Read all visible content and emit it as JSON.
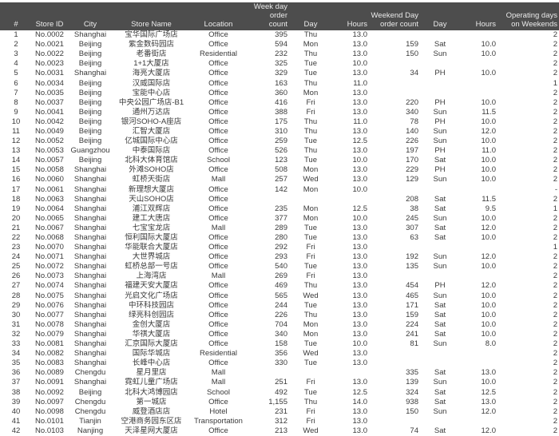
{
  "header": {
    "columns": [
      "#",
      "Store ID",
      "City",
      "Store Name",
      "Location",
      "Week day\norder count",
      "Day",
      "Hours",
      "Weekend Day\norder count",
      "Day",
      "Hours",
      "Operating days\non Weekends"
    ],
    "background_color": "#4d4d4d"
  },
  "rows": [
    [
      "1",
      "No.0002",
      "Shanghai",
      "宝华国际广场店",
      "Office",
      "395",
      "Thu",
      "13.0",
      "",
      "",
      "",
      "2"
    ],
    [
      "2",
      "No.0021",
      "Beijing",
      "紫金数码园店",
      "Office",
      "594",
      "Mon",
      "13.0",
      "159",
      "Sat",
      "10.0",
      "2"
    ],
    [
      "3",
      "No.0022",
      "Beijing",
      "老番街店",
      "Residential",
      "232",
      "Thu",
      "13.0",
      "150",
      "Sun",
      "10.0",
      "2"
    ],
    [
      "4",
      "No.0023",
      "Beijing",
      "1+1大厦店",
      "Office",
      "325",
      "Tue",
      "10.0",
      "",
      "",
      "",
      "2"
    ],
    [
      "5",
      "No.0031",
      "Shanghai",
      "海亮大厦店",
      "Office",
      "329",
      "Tue",
      "13.0",
      "34",
      "PH",
      "10.0",
      "2"
    ],
    [
      "6",
      "No.0034",
      "Beijing",
      "汉威国际店",
      "Office",
      "163",
      "Thu",
      "11.0",
      "",
      "",
      "",
      "1"
    ],
    [
      "7",
      "No.0035",
      "Beijing",
      "宝能中心店",
      "Office",
      "360",
      "Mon",
      "13.0",
      "",
      "",
      "",
      "2"
    ],
    [
      "8",
      "No.0037",
      "Beijing",
      "中央公园广场店-B1",
      "Office",
      "416",
      "Fri",
      "13.0",
      "220",
      "PH",
      "10.0",
      "2"
    ],
    [
      "9",
      "No.0041",
      "Beijing",
      "通州万达店",
      "Office",
      "388",
      "Fri",
      "13.0",
      "340",
      "Sun",
      "11.5",
      "2"
    ],
    [
      "10",
      "No.0042",
      "Beijing",
      "银河SOHO-A座店",
      "Office",
      "175",
      "Thu",
      "11.0",
      "78",
      "PH",
      "10.0",
      "2"
    ],
    [
      "11",
      "No.0049",
      "Beijing",
      "汇智大厦店",
      "Office",
      "310",
      "Thu",
      "13.0",
      "140",
      "Sun",
      "12.0",
      "2"
    ],
    [
      "12",
      "No.0052",
      "Beijing",
      "亿城国际中心店",
      "Office",
      "259",
      "Tue",
      "12.5",
      "226",
      "Sun",
      "10.0",
      "2"
    ],
    [
      "13",
      "No.0053",
      "Guangzhou",
      "中泰国际店",
      "Office",
      "526",
      "Thu",
      "13.0",
      "197",
      "PH",
      "11.0",
      "2"
    ],
    [
      "14",
      "No.0057",
      "Beijing",
      "北科大体育馆店",
      "School",
      "123",
      "Tue",
      "10.0",
      "170",
      "Sat",
      "10.0",
      "2"
    ],
    [
      "15",
      "No.0058",
      "Shanghai",
      "外滩SOHO店",
      "Office",
      "508",
      "Mon",
      "13.0",
      "229",
      "PH",
      "10.0",
      "2"
    ],
    [
      "16",
      "No.0060",
      "Shanghai",
      "虹桥天街店",
      "Mall",
      "257",
      "Wed",
      "13.0",
      "129",
      "Sun",
      "10.0",
      "2"
    ],
    [
      "17",
      "No.0061",
      "Shanghai",
      "新理想大厦店",
      "Office",
      "142",
      "Mon",
      "10.0",
      "",
      "",
      "",
      "-"
    ],
    [
      "18",
      "No.0063",
      "Shanghai",
      "天山SOHO店",
      "Office",
      "",
      "",
      "",
      "208",
      "Sat",
      "11.5",
      "2"
    ],
    [
      "19",
      "No.0064",
      "Shanghai",
      "浦江双辉店",
      "Office",
      "235",
      "Mon",
      "12.5",
      "38",
      "Sat",
      "9.5",
      "1"
    ],
    [
      "20",
      "No.0065",
      "Shanghai",
      "建工大唐店",
      "Office",
      "377",
      "Mon",
      "10.0",
      "245",
      "Sun",
      "10.0",
      "2"
    ],
    [
      "21",
      "No.0067",
      "Shanghai",
      "七宝宝龙店",
      "Mall",
      "289",
      "Tue",
      "13.0",
      "307",
      "Sat",
      "12.0",
      "2"
    ],
    [
      "22",
      "No.0068",
      "Shanghai",
      "恒利国际大厦店",
      "Office",
      "280",
      "Tue",
      "13.0",
      "63",
      "Sat",
      "10.0",
      "2"
    ],
    [
      "23",
      "No.0070",
      "Shanghai",
      "华能联合大厦店",
      "Office",
      "292",
      "Fri",
      "13.0",
      "",
      "",
      "",
      "1"
    ],
    [
      "24",
      "No.0071",
      "Shanghai",
      "大世界城店",
      "Office",
      "293",
      "Fri",
      "13.0",
      "192",
      "Sun",
      "12.0",
      "2"
    ],
    [
      "25",
      "No.0072",
      "Shanghai",
      "虹桥总部一号店",
      "Office",
      "540",
      "Tue",
      "13.0",
      "135",
      "Sun",
      "10.0",
      "2"
    ],
    [
      "26",
      "No.0073",
      "Shanghai",
      "上海湾店",
      "Mall",
      "269",
      "Fri",
      "13.0",
      "",
      "",
      "",
      "2"
    ],
    [
      "27",
      "No.0074",
      "Shanghai",
      "福建天安大厦店",
      "Office",
      "469",
      "Thu",
      "13.0",
      "454",
      "PH",
      "12.0",
      "2"
    ],
    [
      "28",
      "No.0075",
      "Shanghai",
      "光启文化广场店",
      "Office",
      "565",
      "Wed",
      "13.0",
      "465",
      "Sun",
      "10.0",
      "2"
    ],
    [
      "29",
      "No.0076",
      "Shanghai",
      "中环科技园店",
      "Office",
      "244",
      "Tue",
      "13.0",
      "171",
      "Sat",
      "10.0",
      "2"
    ],
    [
      "30",
      "No.0077",
      "Shanghai",
      "绿亮科创园店",
      "Office",
      "226",
      "Thu",
      "13.0",
      "159",
      "Sat",
      "10.0",
      "2"
    ],
    [
      "31",
      "No.0078",
      "Shanghai",
      "金创大厦店",
      "Office",
      "704",
      "Mon",
      "13.0",
      "224",
      "Sat",
      "10.0",
      "2"
    ],
    [
      "32",
      "No.0079",
      "Shanghai",
      "华祺大厦店",
      "Office",
      "340",
      "Mon",
      "13.0",
      "241",
      "Sat",
      "10.0",
      "2"
    ],
    [
      "33",
      "No.0081",
      "Shanghai",
      "汇京国际大厦店",
      "Office",
      "158",
      "Tue",
      "10.0",
      "81",
      "Sun",
      "8.0",
      "2"
    ],
    [
      "34",
      "No.0082",
      "Shanghai",
      "国际华城店",
      "Residential",
      "356",
      "Wed",
      "13.0",
      "",
      "",
      "",
      "2"
    ],
    [
      "35",
      "No.0083",
      "Shanghai",
      "长峰中心店",
      "Office",
      "330",
      "Tue",
      "13.0",
      "",
      "",
      "",
      "2"
    ],
    [
      "36",
      "No.0089",
      "Chengdu",
      "星月里店",
      "Mall",
      "",
      "",
      "",
      "335",
      "Sat",
      "13.0",
      "2"
    ],
    [
      "37",
      "No.0091",
      "Shanghai",
      "霓虹儿童广场店",
      "Mall",
      "251",
      "Fri",
      "13.0",
      "139",
      "Sun",
      "10.0",
      "2"
    ],
    [
      "38",
      "No.0092",
      "Beijing",
      "北科大鸿博园店",
      "School",
      "492",
      "Tue",
      "12.5",
      "324",
      "Sat",
      "12.5",
      "2"
    ],
    [
      "39",
      "No.0097",
      "Chengdu",
      "第一城店",
      "Office",
      "1,155",
      "Thu",
      "14.0",
      "938",
      "Sat",
      "13.0",
      "2"
    ],
    [
      "40",
      "No.0098",
      "Chengdu",
      "威登酒店店",
      "Hotel",
      "231",
      "Fri",
      "13.0",
      "150",
      "Sun",
      "12.0",
      "2"
    ],
    [
      "41",
      "No.0101",
      "Tianjin",
      "空港商务园东区店",
      "Transportation",
      "312",
      "Fri",
      "13.0",
      "",
      "",
      "",
      "2"
    ],
    [
      "42",
      "No.0103",
      "Nanjing",
      "天泽星网大厦店",
      "Office",
      "213",
      "Wed",
      "13.0",
      "74",
      "Sat",
      "12.0",
      "2"
    ]
  ]
}
